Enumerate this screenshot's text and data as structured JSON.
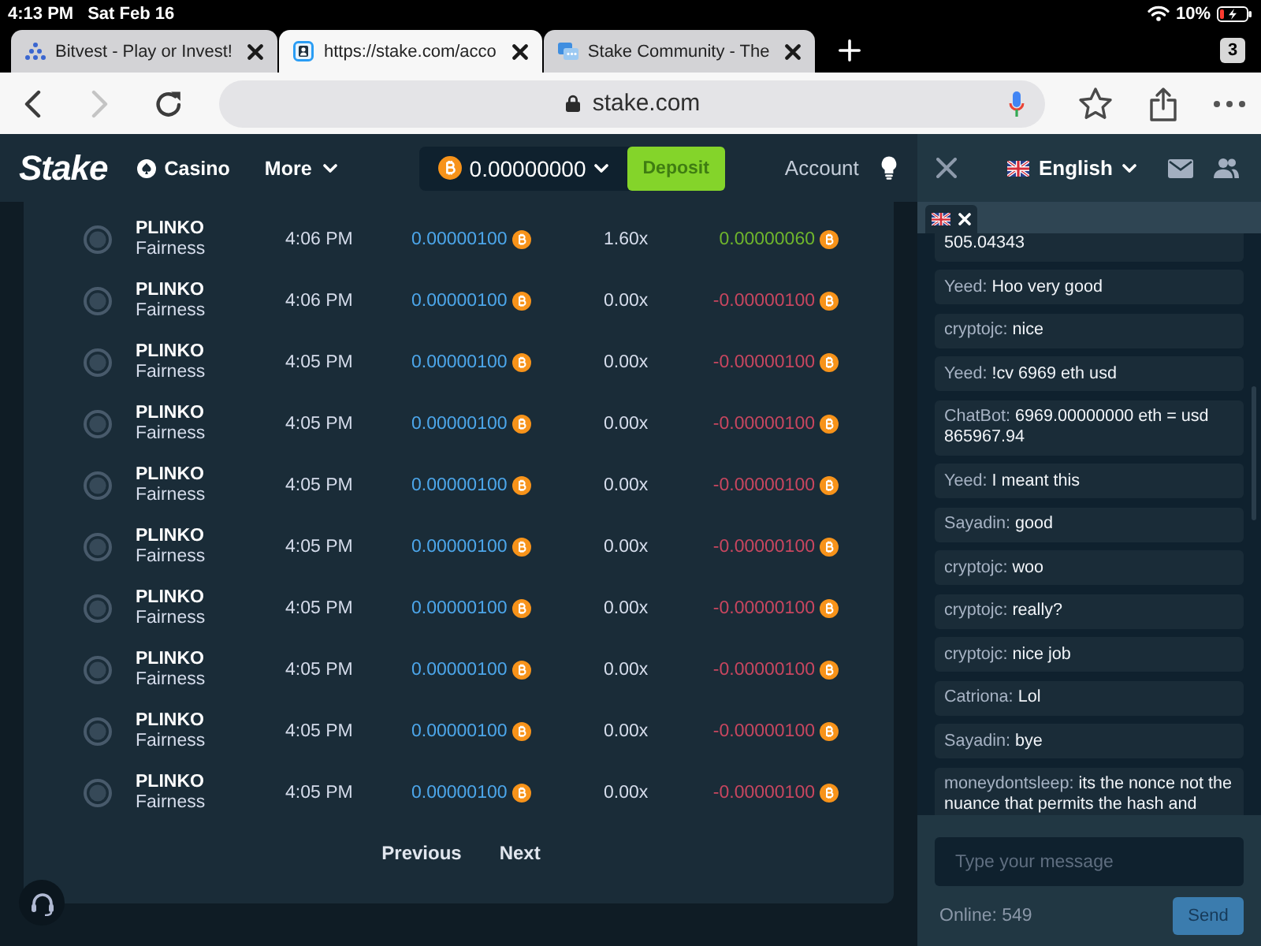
{
  "status_bar": {
    "time": "4:13 PM",
    "date": "Sat Feb 16",
    "battery": "10%"
  },
  "browser": {
    "tabs": [
      {
        "kind": "dots",
        "title": "Bitvest - Play or Invest!",
        "selected": false
      },
      {
        "kind": "portrait",
        "title": "https://stake.com/acco",
        "selected": true
      },
      {
        "kind": "chat",
        "title": "Stake Community - The",
        "selected": false
      }
    ],
    "tab_count": "3",
    "address": "stake.com"
  },
  "header": {
    "logo": "Stake",
    "casino_link": "Casino",
    "more_menu": "More",
    "balance": "0.00000000",
    "deposit_button": "Deposit",
    "account_link": "Account"
  },
  "bets": [
    {
      "game": "PLINKO",
      "link": "Fairness",
      "time": "4:06 PM",
      "bet": "0.00000100",
      "multiplier": "1.60x",
      "payout": "0.00000060",
      "win": true
    },
    {
      "game": "PLINKO",
      "link": "Fairness",
      "time": "4:06 PM",
      "bet": "0.00000100",
      "multiplier": "0.00x",
      "payout": "-0.00000100",
      "win": false
    },
    {
      "game": "PLINKO",
      "link": "Fairness",
      "time": "4:05 PM",
      "bet": "0.00000100",
      "multiplier": "0.00x",
      "payout": "-0.00000100",
      "win": false
    },
    {
      "game": "PLINKO",
      "link": "Fairness",
      "time": "4:05 PM",
      "bet": "0.00000100",
      "multiplier": "0.00x",
      "payout": "-0.00000100",
      "win": false
    },
    {
      "game": "PLINKO",
      "link": "Fairness",
      "time": "4:05 PM",
      "bet": "0.00000100",
      "multiplier": "0.00x",
      "payout": "-0.00000100",
      "win": false
    },
    {
      "game": "PLINKO",
      "link": "Fairness",
      "time": "4:05 PM",
      "bet": "0.00000100",
      "multiplier": "0.00x",
      "payout": "-0.00000100",
      "win": false
    },
    {
      "game": "PLINKO",
      "link": "Fairness",
      "time": "4:05 PM",
      "bet": "0.00000100",
      "multiplier": "0.00x",
      "payout": "-0.00000100",
      "win": false
    },
    {
      "game": "PLINKO",
      "link": "Fairness",
      "time": "4:05 PM",
      "bet": "0.00000100",
      "multiplier": "0.00x",
      "payout": "-0.00000100",
      "win": false
    },
    {
      "game": "PLINKO",
      "link": "Fairness",
      "time": "4:05 PM",
      "bet": "0.00000100",
      "multiplier": "0.00x",
      "payout": "-0.00000100",
      "win": false
    },
    {
      "game": "PLINKO",
      "link": "Fairness",
      "time": "4:05 PM",
      "bet": "0.00000100",
      "multiplier": "0.00x",
      "payout": "-0.00000100",
      "win": false
    }
  ],
  "pagination": [
    {
      "label": "Previous"
    },
    {
      "label": "Next"
    }
  ],
  "chat": {
    "language": "English",
    "messages": [
      {
        "text": "505.04343"
      },
      {
        "author": "Yeed:",
        "text": "Hoo very good"
      },
      {
        "author": "cryptojc:",
        "text": "nice"
      },
      {
        "author": "Yeed:",
        "text": "!cv 6969 eth usd"
      },
      {
        "author": "ChatBot:",
        "text": "6969.00000000 eth = usd 865967.94"
      },
      {
        "author": "Yeed:",
        "text": "I meant this"
      },
      {
        "author": "Sayadin:",
        "text": "good"
      },
      {
        "author": "cryptojc:",
        "text": "woo"
      },
      {
        "author": "cryptojc:",
        "text": "really?"
      },
      {
        "author": "cryptojc:",
        "text": "nice job"
      },
      {
        "author": "Catriona:",
        "text": "Lol"
      },
      {
        "author": "Sayadin:",
        "text": "bye"
      },
      {
        "author": "moneydontsleep:",
        "text": "its the nonce not the nuance that permits the hash and"
      }
    ],
    "placeholder": "Type your message",
    "online": "Online: 549",
    "send_button": "Send"
  }
}
